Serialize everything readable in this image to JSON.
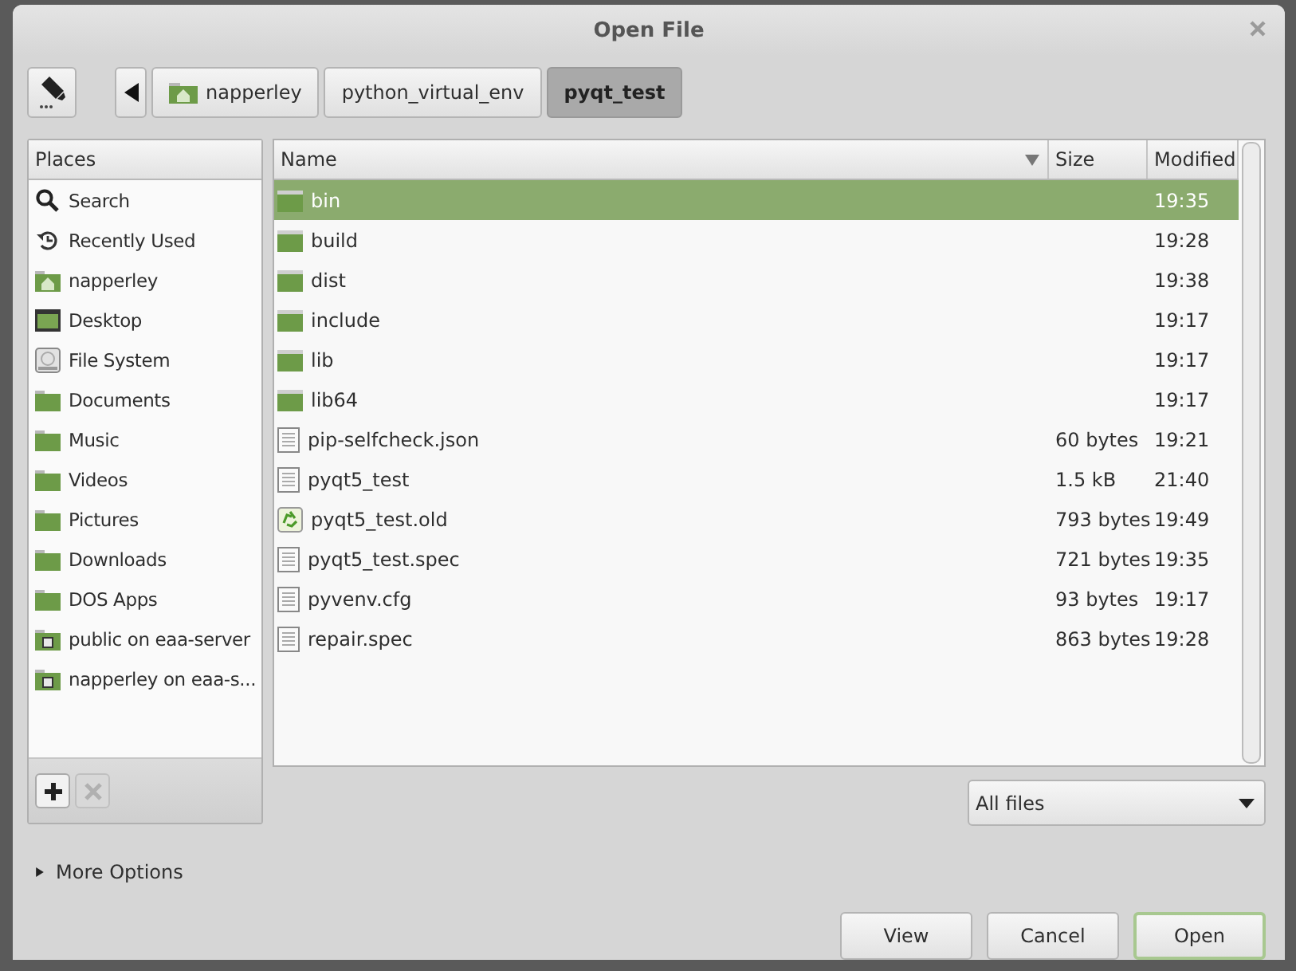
{
  "window": {
    "title": "Open File"
  },
  "path_bar": {
    "buttons": [
      {
        "label": "napperley",
        "home": true,
        "selected": false
      },
      {
        "label": "python_virtual_env",
        "home": false,
        "selected": false
      },
      {
        "label": "pyqt_test",
        "home": false,
        "selected": true
      }
    ]
  },
  "places": {
    "header": "Places",
    "items": [
      {
        "label": "Search",
        "kind": "search"
      },
      {
        "label": "Recently Used",
        "kind": "recent"
      },
      {
        "label": "napperley",
        "kind": "home"
      },
      {
        "label": "Desktop",
        "kind": "desktop"
      },
      {
        "label": "File System",
        "kind": "drive"
      },
      {
        "label": "Documents",
        "kind": "folder"
      },
      {
        "label": "Music",
        "kind": "folder"
      },
      {
        "label": "Videos",
        "kind": "folder"
      },
      {
        "label": "Pictures",
        "kind": "folder"
      },
      {
        "label": "Downloads",
        "kind": "folder"
      },
      {
        "label": "DOS Apps",
        "kind": "folder"
      },
      {
        "label": "public on eaa-server",
        "kind": "network"
      },
      {
        "label": "napperley on eaa-s...",
        "kind": "network"
      }
    ],
    "add_disabled": false,
    "remove_disabled": true
  },
  "files": {
    "columns": [
      "Name",
      "Size",
      "Modified"
    ],
    "rows": [
      {
        "name": "bin",
        "kind": "folder",
        "size": "",
        "modified": "19:35",
        "selected": true
      },
      {
        "name": "build",
        "kind": "folder",
        "size": "",
        "modified": "19:28",
        "selected": false
      },
      {
        "name": "dist",
        "kind": "folder",
        "size": "",
        "modified": "19:38",
        "selected": false
      },
      {
        "name": "include",
        "kind": "folder",
        "size": "",
        "modified": "19:17",
        "selected": false
      },
      {
        "name": "lib",
        "kind": "folder",
        "size": "",
        "modified": "19:17",
        "selected": false
      },
      {
        "name": "lib64",
        "kind": "folder",
        "size": "",
        "modified": "19:17",
        "selected": false
      },
      {
        "name": "pip-selfcheck.json",
        "kind": "text",
        "size": "60 bytes",
        "modified": "19:21",
        "selected": false
      },
      {
        "name": "pyqt5_test",
        "kind": "text",
        "size": "1.5 kB",
        "modified": "21:40",
        "selected": false
      },
      {
        "name": "pyqt5_test.old",
        "kind": "recycle",
        "size": "793 bytes",
        "modified": "19:49",
        "selected": false
      },
      {
        "name": "pyqt5_test.spec",
        "kind": "text",
        "size": "721 bytes",
        "modified": "19:35",
        "selected": false
      },
      {
        "name": "pyvenv.cfg",
        "kind": "text",
        "size": "93 bytes",
        "modified": "19:17",
        "selected": false
      },
      {
        "name": "repair.spec",
        "kind": "text",
        "size": "863 bytes",
        "modified": "19:28",
        "selected": false
      }
    ]
  },
  "filter": {
    "value": "All files"
  },
  "more_options": {
    "label": "More Options",
    "expanded": false
  },
  "buttons": [
    {
      "label": "View",
      "default": false
    },
    {
      "label": "Cancel",
      "default": false
    },
    {
      "label": "Open",
      "default": true
    }
  ]
}
